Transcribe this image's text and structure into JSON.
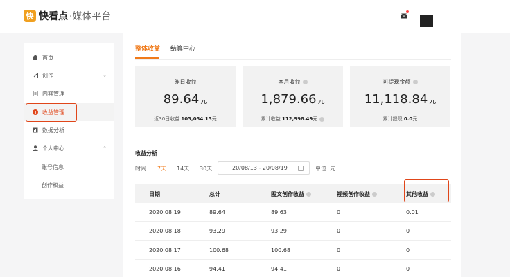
{
  "header": {
    "logo_mark": "快",
    "brand": "快看点",
    "subtitle": "·媒体平台",
    "mail_icon": "mail-icon",
    "accent": "#f07a1a"
  },
  "sidebar": {
    "items": [
      {
        "label": "首页",
        "icon": "home-icon"
      },
      {
        "label": "创作",
        "icon": "edit-icon",
        "chevron": "⌄"
      },
      {
        "label": "内容管理",
        "icon": "document-icon"
      },
      {
        "label": "收益管理",
        "icon": "income-icon"
      },
      {
        "label": "数据分析",
        "icon": "chart-icon"
      },
      {
        "label": "个人中心",
        "icon": "user-icon",
        "chevron": "⌃"
      }
    ],
    "subitems": [
      "账号信息",
      "创作权益"
    ]
  },
  "tabs": [
    "整体收益",
    "结算中心"
  ],
  "cards": [
    {
      "title": "昨日收益",
      "value": "89.64",
      "unit": "元",
      "foot_label": "近30日收益 ",
      "foot_value": "103,034.13",
      "foot_unit": "元"
    },
    {
      "title": "本月收益",
      "value": "1,879.66",
      "unit": "元",
      "foot_label": "累计收益 ",
      "foot_value": "112,998.49",
      "foot_unit": "元"
    },
    {
      "title": "可提现金额",
      "value": "11,118.84",
      "unit": "元",
      "foot_label": "累计提现 ",
      "foot_value": "0.0",
      "foot_unit": "元"
    }
  ],
  "analysis": {
    "title": "收益分析",
    "time_label": "时间",
    "filters": [
      "7天",
      "14天",
      "30天"
    ],
    "date_range": "20/08/13  -  20/08/19",
    "unit_label": "单位: 元"
  },
  "table": {
    "headers": [
      "日期",
      "总计",
      "图文创作收益",
      "视频创作收益",
      "其他收益"
    ],
    "rows": [
      [
        "2020.08.19",
        "89.64",
        "89.63",
        "0",
        "0.01"
      ],
      [
        "2020.08.18",
        "93.29",
        "93.29",
        "0",
        "0"
      ],
      [
        "2020.08.17",
        "100.68",
        "100.68",
        "0",
        "0"
      ],
      [
        "2020.08.16",
        "94.41",
        "94.41",
        "0",
        "0"
      ]
    ]
  }
}
